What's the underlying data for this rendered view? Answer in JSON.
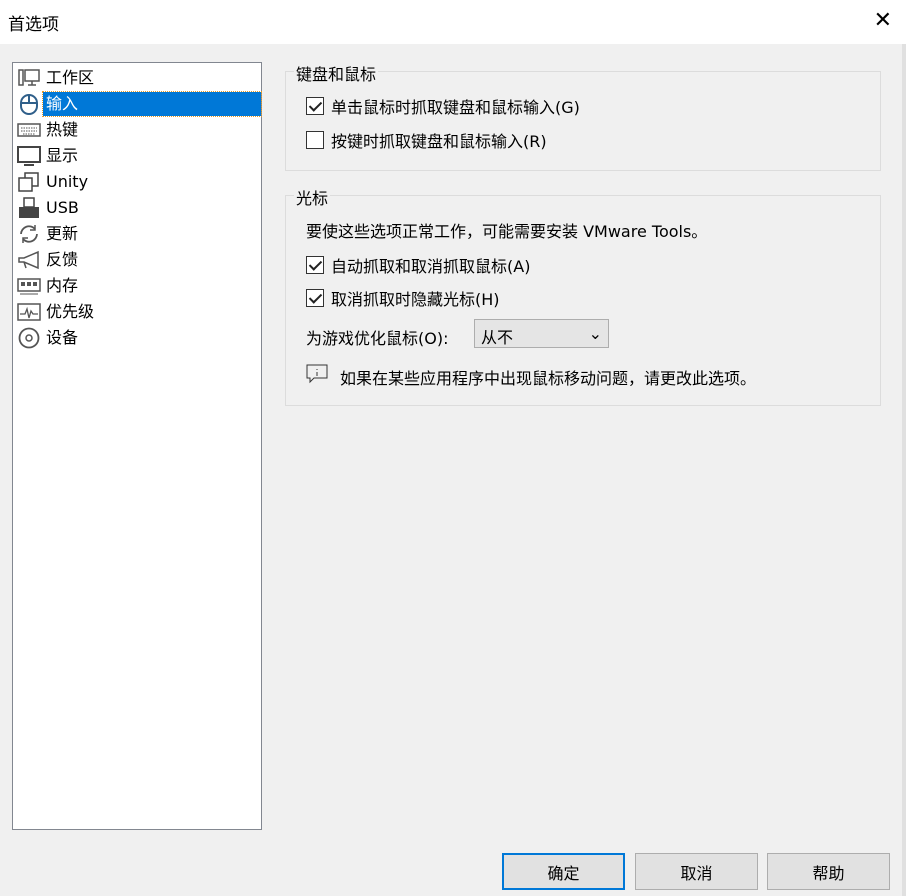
{
  "window": {
    "title": "首选项",
    "close": "✕"
  },
  "sidebar": {
    "items": [
      {
        "label": "工作区",
        "icon": "workspace-icon"
      },
      {
        "label": "输入",
        "icon": "mouse-icon",
        "selected": true
      },
      {
        "label": "热键",
        "icon": "keyboard-icon"
      },
      {
        "label": "显示",
        "icon": "monitor-icon"
      },
      {
        "label": "Unity",
        "icon": "unity-icon"
      },
      {
        "label": "USB",
        "icon": "usb-icon"
      },
      {
        "label": "更新",
        "icon": "refresh-icon"
      },
      {
        "label": "反馈",
        "icon": "megaphone-icon"
      },
      {
        "label": "内存",
        "icon": "memory-icon"
      },
      {
        "label": "优先级",
        "icon": "priority-icon"
      },
      {
        "label": "设备",
        "icon": "disc-icon"
      }
    ]
  },
  "keyboard_mouse": {
    "title": "键盘和鼠标",
    "grab_on_click": {
      "label": "单击鼠标时抓取键盘和鼠标输入(G)",
      "checked": true
    },
    "grab_on_key": {
      "label": "按键时抓取键盘和鼠标输入(R)",
      "checked": false
    }
  },
  "cursor": {
    "title": "光标",
    "note": "要使这些选项正常工作，可能需要安装 VMware Tools。",
    "auto_grab": {
      "label": "自动抓取和取消抓取鼠标(A)",
      "checked": true
    },
    "hide_cursor": {
      "label": "取消抓取时隐藏光标(H)",
      "checked": true
    },
    "optimize_label": "为游戏优化鼠标(O):",
    "optimize_value": "从不",
    "info": "如果在某些应用程序中出现鼠标移动问题，请更改此选项。"
  },
  "buttons": {
    "ok": "确定",
    "cancel": "取消",
    "help": "帮助"
  },
  "colors": {
    "accent": "#0078d7"
  }
}
